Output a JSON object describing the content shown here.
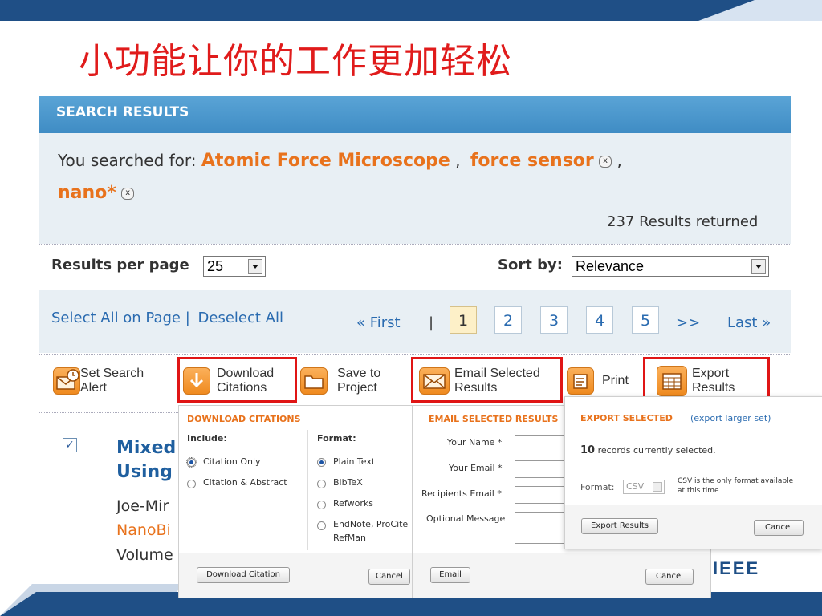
{
  "slide": {
    "title": "小功能让你的工作更加轻松"
  },
  "search_results": {
    "header": "SEARCH RESULTS",
    "you_searched_for": "You searched for:",
    "terms": [
      "Atomic Force Microscope",
      "force sensor",
      "nano*"
    ],
    "separator": ",",
    "remove_glyph": "x",
    "results_count": "237 Results returned",
    "results_per_page_label": "Results per page",
    "results_per_page_value": "25",
    "sort_by_label": "Sort by:",
    "sort_by_value": "Relevance",
    "select_all": "Select All on Page |",
    "deselect_all": "Deselect All",
    "pager": {
      "first": "« First",
      "divider": "|",
      "pages": [
        "1",
        "2",
        "3",
        "4",
        "5"
      ],
      "next": ">>",
      "last": "Last »",
      "current": "1"
    }
  },
  "toolbar": {
    "set_alert": [
      "Set Search",
      "Alert"
    ],
    "download": [
      "Download",
      "Citations"
    ],
    "save": [
      "Save to",
      "Project"
    ],
    "email": [
      "Email Selected",
      "Results"
    ],
    "print": "Print",
    "export": [
      "Export",
      "Results"
    ]
  },
  "result": {
    "check_glyph": "✓",
    "title_lines": [
      "Mixed",
      "Using"
    ],
    "authors": "Joe-Mir",
    "publication": "NanoBi",
    "volume": "Volume"
  },
  "download_popup": {
    "title": "DOWNLOAD CITATIONS",
    "include_label": "Include:",
    "include_options": [
      "Citation Only",
      "Citation & Abstract"
    ],
    "format_label": "Format:",
    "format_options": [
      "Plain Text",
      "BibTeX",
      "Refworks",
      "EndNote, ProCite",
      "RefMan"
    ],
    "download_button": "Download Citation",
    "cancel_button": "Cancel"
  },
  "email_popup": {
    "title": "EMAIL SELECTED RESULTS",
    "your_name": "Your Name *",
    "your_email": "Your Email *",
    "recipients_email": "Recipients Email *",
    "optional_message": "Optional Message",
    "email_button": "Email",
    "cancel_button": "Cancel"
  },
  "export_popup": {
    "title": "EXPORT SELECTED",
    "larger_set": "(export larger set)",
    "count": "10",
    "count_text": "records currently selected.",
    "format_label": "Format:",
    "format_value": "CSV",
    "format_note": [
      "CSV is the only format available",
      "at this time"
    ],
    "export_button": "Export Results",
    "cancel_button": "Cancel"
  },
  "logo": "IEEE",
  "colors": {
    "accent_orange": "#e8721c",
    "link_blue": "#2a6bb0",
    "header_blue": "#4a96cc",
    "title_red": "#e01b1b",
    "highlight_red": "#e01515"
  }
}
